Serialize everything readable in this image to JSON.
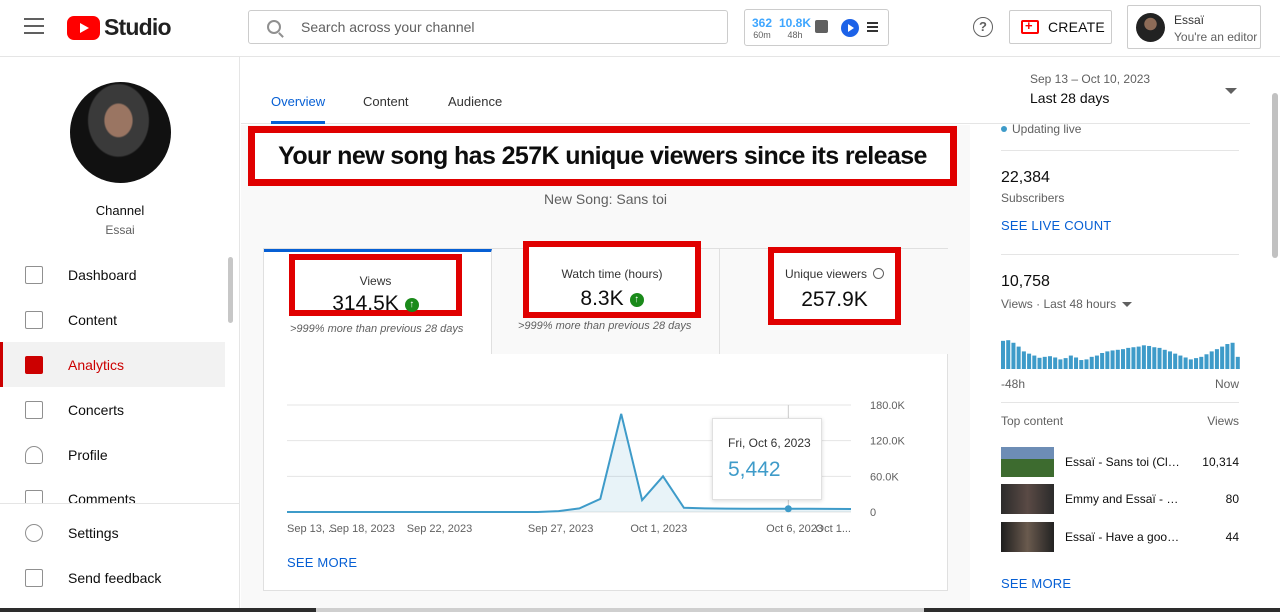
{
  "header": {
    "logo_text": "Studio",
    "search_placeholder": "Search across your channel",
    "stats": [
      {
        "value": "362",
        "period": "60m"
      },
      {
        "value": "10.8K",
        "period": "48h"
      }
    ],
    "help_symbol": "?",
    "create_label": "CREATE",
    "account_name": "Essaï",
    "account_role": "You're an editor"
  },
  "sidebar": {
    "channel_label": "Channel",
    "channel_name": "Essai",
    "items": [
      {
        "label": "Dashboard",
        "icon": "dashboard-icon"
      },
      {
        "label": "Content",
        "icon": "content-icon"
      },
      {
        "label": "Analytics",
        "icon": "analytics-icon",
        "active": true
      },
      {
        "label": "Concerts",
        "icon": "concerts-icon"
      },
      {
        "label": "Profile",
        "icon": "profile-icon"
      },
      {
        "label": "Comments",
        "icon": "comments-icon"
      },
      {
        "label": "Settings",
        "icon": "settings-icon"
      },
      {
        "label": "Send feedback",
        "icon": "feedback-icon"
      }
    ]
  },
  "tabs": [
    {
      "label": "Overview",
      "active": true
    },
    {
      "label": "Content"
    },
    {
      "label": "Audience"
    }
  ],
  "date_range": {
    "range": "Sep 13 – Oct 10, 2023",
    "label": "Last 28 days"
  },
  "headline": "Your new song has 257K unique viewers since its release",
  "subheadline": "New Song: Sans toi",
  "metrics": [
    {
      "label": "Views",
      "value": "314.5K",
      "note": ">999% more than previous 28 days"
    },
    {
      "label": "Watch time (hours)",
      "value": "8.3K",
      "note": ">999% more than previous 28 days"
    },
    {
      "label": "Unique viewers",
      "value": "257.9K"
    }
  ],
  "chart_data": {
    "type": "line",
    "x_tick_labels": [
      "Sep 13, ...",
      "Sep 18, 2023",
      "Sep 22, 2023",
      "Sep 27, 2023",
      "Oct 1, 2023",
      "Oct 6, 2023",
      "Oct 1..."
    ],
    "y_tick_labels": [
      "180.0K",
      "120.0K",
      "60.0K",
      "0"
    ],
    "ylim": [
      0,
      180000
    ],
    "series": [
      {
        "values": [
          0,
          0,
          0,
          0,
          0,
          0,
          0,
          0,
          0,
          0,
          0,
          0,
          0,
          1500,
          6000,
          22000,
          165000,
          20000,
          60000,
          7000,
          6000,
          5800,
          5600,
          5400,
          5442,
          5300,
          5200,
          5100
        ]
      }
    ],
    "highlight_index": 24,
    "color": "#3e9bc9"
  },
  "tooltip": {
    "date": "Fri, Oct 6, 2023",
    "value": "5,442"
  },
  "see_more_main": "SEE MORE",
  "right_panel": {
    "live_text": "Updating live",
    "subscribers_value": "22,384",
    "subscribers_label": "Subscribers",
    "see_live_count": "SEE LIVE COUNT",
    "views_value": "10,758",
    "views_label": "Views · Last 48 hours",
    "bars": [
      0.88,
      0.9,
      0.82,
      0.7,
      0.55,
      0.48,
      0.42,
      0.35,
      0.38,
      0.4,
      0.36,
      0.3,
      0.34,
      0.42,
      0.36,
      0.28,
      0.3,
      0.38,
      0.42,
      0.5,
      0.55,
      0.58,
      0.6,
      0.62,
      0.66,
      0.68,
      0.7,
      0.74,
      0.72,
      0.68,
      0.66,
      0.6,
      0.55,
      0.48,
      0.42,
      0.36,
      0.3,
      0.34,
      0.38,
      0.46,
      0.55,
      0.62,
      0.7,
      0.78,
      0.82,
      0.38
    ],
    "bar_color": "#3e9bc9",
    "axis_start": "-48h",
    "axis_end": "Now",
    "top_content_label": "Top content",
    "views_col_label": "Views",
    "top_content": [
      {
        "title": "Essaï - Sans toi (Clip Officiel)",
        "views": "10,314"
      },
      {
        "title": "Emmy and Essaï - EREB...",
        "views": "80"
      },
      {
        "title": "Essaï - Have a good day",
        "views": "44"
      }
    ],
    "see_more": "SEE MORE"
  }
}
